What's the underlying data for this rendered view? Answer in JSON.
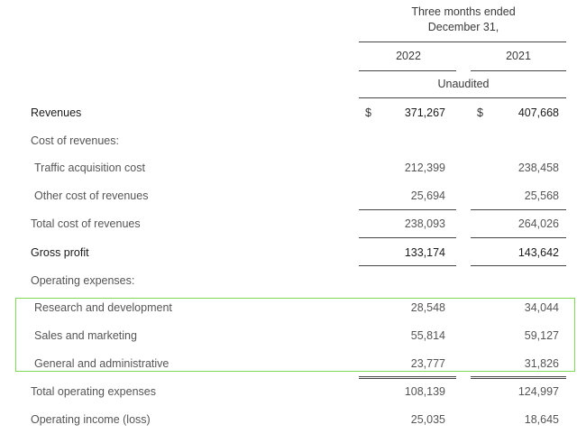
{
  "header": {
    "period_line1": "Three months ended",
    "period_line2": "December 31,",
    "col1": "2022",
    "col2": "2021",
    "audit_note": "Unaudited"
  },
  "rows": [
    {
      "label": "Revenues",
      "v1": "371,267",
      "v2": "407,668",
      "currency": "$"
    },
    {
      "label": "Cost of revenues:",
      "v1": "",
      "v2": ""
    },
    {
      "label": "Traffic acquisition cost",
      "v1": "212,399",
      "v2": "238,458"
    },
    {
      "label": "Other cost of revenues",
      "v1": "25,694",
      "v2": "25,568"
    },
    {
      "label": "Total cost of revenues",
      "v1": "238,093",
      "v2": "264,026"
    },
    {
      "label": "Gross profit",
      "v1": "133,174",
      "v2": "143,642"
    },
    {
      "label": "Operating expenses:",
      "v1": "",
      "v2": ""
    },
    {
      "label": "Research and development",
      "v1": "28,548",
      "v2": "34,044"
    },
    {
      "label": "Sales and marketing",
      "v1": "55,814",
      "v2": "59,127"
    },
    {
      "label": "General and administrative",
      "v1": "23,777",
      "v2": "31,826"
    },
    {
      "label": "Total operating expenses",
      "v1": "108,139",
      "v2": "124,997"
    },
    {
      "label": "Operating income (loss)",
      "v1": "25,035",
      "v2": "18,645"
    }
  ],
  "colors": {
    "highlight": "#7ed957",
    "rules": "#444444"
  }
}
